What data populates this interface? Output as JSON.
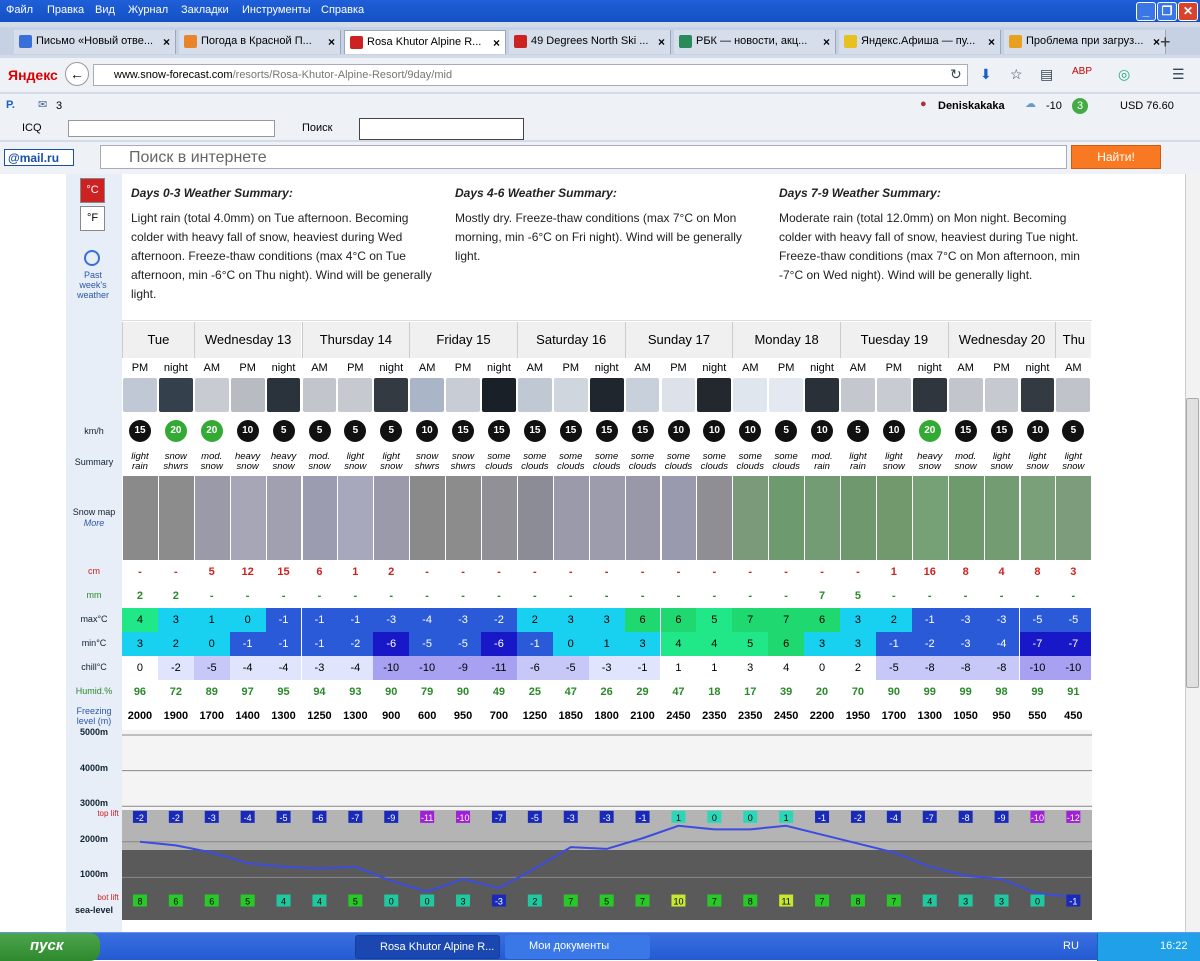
{
  "menubar": {
    "items": [
      "Файл",
      "Правка",
      "Вид",
      "Журнал",
      "Закладки",
      "Инструменты",
      "Справка"
    ]
  },
  "tabs": [
    {
      "label": "Письмо «Новый отве...",
      "color": "#3a6fd8"
    },
    {
      "label": "Погода в Красной П...",
      "color": "#e8852a"
    },
    {
      "label": "Rosa Khutor Alpine R...",
      "color": "#c22",
      "active": true
    },
    {
      "label": "49 Degrees North Ski ...",
      "color": "#c22"
    },
    {
      "label": "РБК — новости, акц...",
      "color": "#2a8a5a"
    },
    {
      "label": "Яндекс.Афиша — пу...",
      "color": "#e8c020"
    },
    {
      "label": "Проблема при загруз...",
      "color": "#e8a020"
    }
  ],
  "address": {
    "domain": "www.snow-forecast.com",
    "path": "/resorts/Rosa-Khutor-Alpine-Resort/9day/mid"
  },
  "browser_logo": "Яндекс",
  "bookmarks": {
    "mail_count": "3",
    "user": "Deniskakaka",
    "temp": "-10",
    "badge": "3",
    "usd": "USD 76.60",
    "icq": "ICQ",
    "search_btn": "Поиск"
  },
  "mailru": {
    "logo": "@mail.ru",
    "placeholder": "Поиск в интернете",
    "button": "Найти!"
  },
  "units": {
    "c": "°C",
    "f": "°F",
    "past": "Past week's weather"
  },
  "summaries": [
    {
      "title": "Days 0-3 Weather Summary:",
      "text": "Light rain (total 4.0mm) on Tue afternoon. Becoming colder with heavy fall of snow, heaviest during Wed afternoon. Freeze-thaw conditions (max 4°C on Tue afternoon, min -6°C on Thu night). Wind will be generally light."
    },
    {
      "title": "Days 4-6 Weather Summary:",
      "text": "Mostly dry. Freeze-thaw conditions (max 7°C on Mon morning, min -6°C on Fri night). Wind will be generally light."
    },
    {
      "title": "Days 7-9 Weather Summary:",
      "text": "Moderate rain (total 12.0mm) on Mon night. Becoming colder with heavy fall of snow, heaviest during Tue night. Freeze-thaw conditions (max 7°C on Mon afternoon, min -7°C on Wed night). Wind will be generally light."
    }
  ],
  "row_labels": {
    "kmh": "km/h",
    "summary": "Summary",
    "snowmap": "Snow map",
    "more": "More",
    "cm": "cm",
    "mm": "mm",
    "max": "max°C",
    "min": "min°C",
    "chill": "chill°C",
    "humid": "Humid.%",
    "freezing": "Freezing level (m)"
  },
  "days": [
    "Tue",
    "Wednesday 13",
    "Thursday 14",
    "Friday 15",
    "Saturday 16",
    "Sunday 17",
    "Monday 18",
    "Tuesday 19",
    "Wednesday 20",
    "Thu"
  ],
  "periods": [
    "PM",
    "night",
    "AM",
    "PM",
    "night",
    "AM",
    "PM",
    "night",
    "AM",
    "PM",
    "night",
    "AM",
    "PM",
    "night",
    "AM",
    "PM",
    "night",
    "AM",
    "PM",
    "night",
    "AM",
    "PM",
    "night",
    "AM",
    "PM",
    "night",
    "AM"
  ],
  "wind": [
    "15",
    "20",
    "20",
    "10",
    "5",
    "5",
    "5",
    "5",
    "10",
    "15",
    "15",
    "15",
    "15",
    "15",
    "15",
    "10",
    "10",
    "10",
    "5",
    "10",
    "5",
    "10",
    "20",
    "15",
    "15",
    "10",
    "5"
  ],
  "summary": [
    "light rain",
    "snow shwrs",
    "mod. snow",
    "heavy snow",
    "heavy snow",
    "mod. snow",
    "light snow",
    "light snow",
    "snow shwrs",
    "snow shwrs",
    "some clouds",
    "some clouds",
    "some clouds",
    "some clouds",
    "some clouds",
    "some clouds",
    "some clouds",
    "some clouds",
    "some clouds",
    "mod. rain",
    "light rain",
    "light snow",
    "heavy snow",
    "mod. snow",
    "light snow",
    "light snow",
    "light snow"
  ],
  "snow_cm": [
    "-",
    "-",
    "5",
    "12",
    "15",
    "6",
    "1",
    "2",
    "-",
    "-",
    "-",
    "-",
    "-",
    "-",
    "-",
    "-",
    "-",
    "-",
    "-",
    "-",
    "-",
    "1",
    "16",
    "8",
    "4",
    "8",
    "3"
  ],
  "rain_mm": [
    "2",
    "2",
    "-",
    "-",
    "-",
    "-",
    "-",
    "-",
    "-",
    "-",
    "-",
    "-",
    "-",
    "-",
    "-",
    "-",
    "-",
    "-",
    "-",
    "7",
    "5",
    "-",
    "-",
    "-",
    "-",
    "-",
    "-"
  ],
  "max_c": [
    "4",
    "3",
    "1",
    "0",
    "-1",
    "-1",
    "-1",
    "-3",
    "-4",
    "-3",
    "-2",
    "2",
    "3",
    "3",
    "6",
    "6",
    "5",
    "7",
    "7",
    "6",
    "3",
    "2",
    "-1",
    "-3",
    "-3",
    "-5",
    "-5"
  ],
  "min_c": [
    "3",
    "2",
    "0",
    "-1",
    "-1",
    "-1",
    "-2",
    "-6",
    "-5",
    "-5",
    "-6",
    "-1",
    "0",
    "1",
    "3",
    "4",
    "4",
    "5",
    "6",
    "3",
    "3",
    "-1",
    "-2",
    "-3",
    "-4",
    "-7",
    "-7"
  ],
  "chill_c": [
    "0",
    "-2",
    "-5",
    "-4",
    "-4",
    "-3",
    "-4",
    "-10",
    "-10",
    "-9",
    "-11",
    "-6",
    "-5",
    "-3",
    "-1",
    "1",
    "1",
    "3",
    "4",
    "0",
    "2",
    "-5",
    "-8",
    "-8",
    "-8",
    "-10",
    "-10"
  ],
  "humid": [
    "96",
    "72",
    "89",
    "97",
    "95",
    "94",
    "93",
    "90",
    "79",
    "90",
    "49",
    "25",
    "47",
    "26",
    "29",
    "47",
    "18",
    "17",
    "39",
    "20",
    "70",
    "90",
    "99",
    "99",
    "98",
    "99",
    "91"
  ],
  "freezing": [
    "2000",
    "1900",
    "1700",
    "1400",
    "1300",
    "1250",
    "1300",
    "900",
    "600",
    "950",
    "700",
    "1250",
    "1850",
    "1800",
    "2100",
    "2450",
    "2350",
    "2350",
    "2450",
    "2200",
    "1950",
    "1700",
    "1300",
    "1050",
    "950",
    "550",
    "450"
  ],
  "chart": {
    "levels": [
      "5000m",
      "4000m",
      "3000m",
      "2000m",
      "1000m",
      "sea-level"
    ],
    "top_lift": "top lift",
    "bot_lift": "bot lift",
    "top": [
      "-2",
      "-2",
      "-3",
      "-4",
      "-5",
      "-6",
      "-7",
      "-9",
      "-11",
      "-10",
      "-7",
      "-5",
      "-3",
      "-3",
      "-1",
      "1",
      "0",
      "0",
      "1",
      "-1",
      "-2",
      "-4",
      "-7",
      "-8",
      "-9",
      "-10",
      "-12"
    ],
    "bot": [
      "8",
      "6",
      "6",
      "5",
      "4",
      "4",
      "5",
      "0",
      "0",
      "3",
      "-3",
      "2",
      "7",
      "5",
      "7",
      "10",
      "7",
      "8",
      "11",
      "7",
      "8",
      "7",
      "4",
      "3",
      "3",
      "0",
      "-1"
    ]
  },
  "taskbar": {
    "start": "пуск",
    "tasks": [
      "Rosa Khutor Alpine R...",
      "Мои документы"
    ],
    "lang": "RU",
    "clock": "16:22"
  }
}
